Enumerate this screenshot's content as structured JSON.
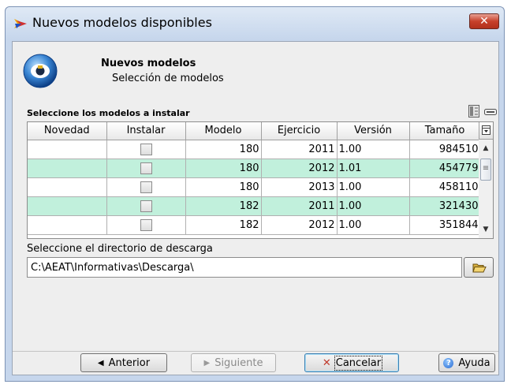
{
  "window": {
    "title": "Nuevos modelos disponibles",
    "close_label": "✕"
  },
  "header": {
    "title": "Nuevos modelos",
    "subtitle": "Selección de modelos"
  },
  "table": {
    "section_label": "Seleccione los modelos a instalar",
    "columns": [
      "Novedad",
      "Instalar",
      "Modelo",
      "Ejercicio",
      "Versión",
      "Tamaño"
    ],
    "rows": [
      {
        "novedad": "",
        "instalar": false,
        "modelo": "180",
        "ejercicio": "2011",
        "version": "1.00",
        "tamano": "984510"
      },
      {
        "novedad": "",
        "instalar": false,
        "modelo": "180",
        "ejercicio": "2012",
        "version": "1.01",
        "tamano": "454779"
      },
      {
        "novedad": "",
        "instalar": false,
        "modelo": "180",
        "ejercicio": "2013",
        "version": "1.00",
        "tamano": "458110"
      },
      {
        "novedad": "",
        "instalar": false,
        "modelo": "182",
        "ejercicio": "2011",
        "version": "1.00",
        "tamano": "321430"
      },
      {
        "novedad": "",
        "instalar": false,
        "modelo": "182",
        "ejercicio": "2012",
        "version": "1.00",
        "tamano": "351844"
      }
    ]
  },
  "download": {
    "label": "Seleccione el directorio de descarga",
    "path": "C:\\AEAT\\Informativas\\Descarga\\"
  },
  "buttons": {
    "anterior": "Anterior",
    "siguiente": "Siguiente",
    "cancelar": "Cancelar",
    "ayuda": "Ayuda"
  },
  "colors": {
    "alt_row": "#c1f0dc",
    "title_bar": "#c6d6ec",
    "close_button": "#c7412b"
  }
}
